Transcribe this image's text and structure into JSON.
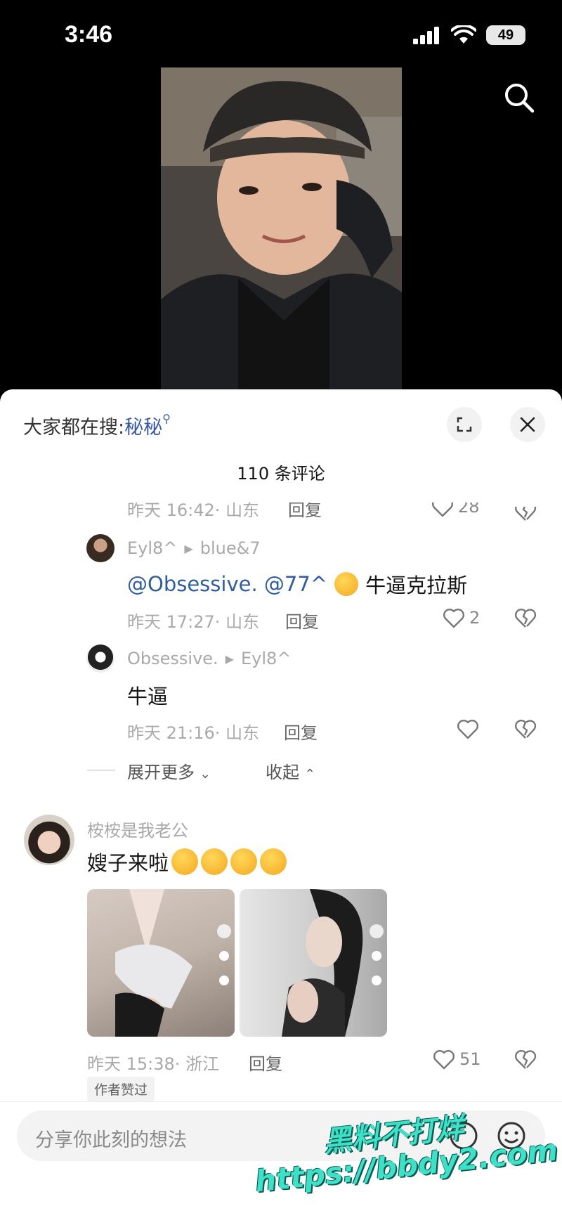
{
  "status_bar": {
    "time": "3:46",
    "battery": "49"
  },
  "sheet": {
    "hot_search_prefix": "大家都在搜:",
    "hot_search_keyword": "秘秘",
    "comment_count_title": "110 条评论"
  },
  "comments": [
    {
      "time": "昨天 16:42",
      "location": "山东",
      "reply": "回复",
      "likes": "28"
    },
    {
      "user": "Eyl8^",
      "reply_to": "blue&7",
      "mention_text": "@Obsessive. @77^",
      "text": "牛逼克拉斯",
      "time": "昨天 17:27",
      "location": "山东",
      "reply": "回复",
      "likes": "2"
    },
    {
      "user": "Obsessive.",
      "reply_to": "Eyl8^",
      "text": "牛逼",
      "time": "昨天 21:16",
      "location": "山东",
      "reply": "回复"
    },
    {
      "user": "桉桉是我老公",
      "text": "嫂子来啦",
      "time": "昨天 15:38",
      "location": "浙江",
      "reply": "回复",
      "likes": "51",
      "badge": "作者赞过"
    }
  ],
  "expand": {
    "more": "展开更多",
    "collapse": "收起"
  },
  "input": {
    "placeholder": "分享你此刻的想法"
  },
  "watermark": {
    "line1": "黑料不打烊",
    "line2": "https://bbdy2.com"
  },
  "colors": {
    "mention": "#2f5d9e",
    "watermark": "#3ee0c8"
  }
}
